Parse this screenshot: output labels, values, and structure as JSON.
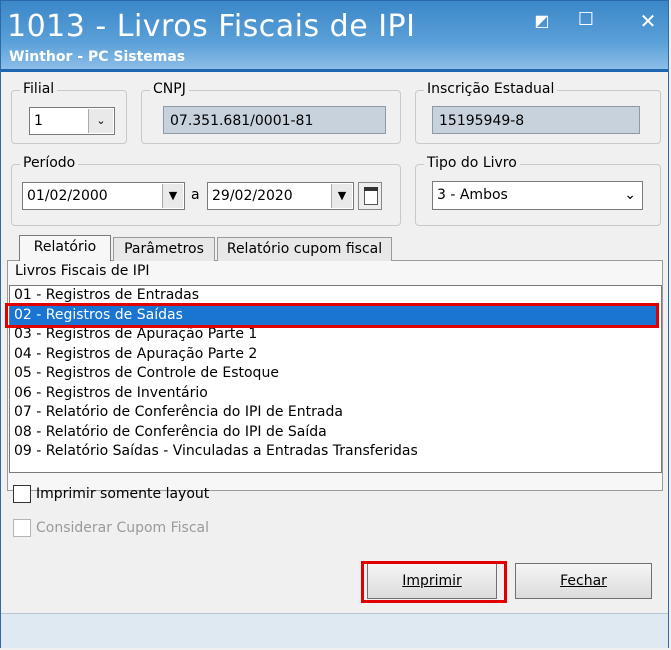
{
  "window": {
    "title": "1013 - Livros Fiscais de IPI",
    "subtitle": "Winthor - PC Sistemas",
    "controls": {
      "restore": "◩",
      "maximize": "☐",
      "close": "✕"
    }
  },
  "filial": {
    "label": "Filial",
    "value": "1"
  },
  "cnpj": {
    "label": "CNPJ",
    "value": "07.351.681/0001-81"
  },
  "inscricao": {
    "label": "Inscrição Estadual",
    "value": "15195949-8"
  },
  "periodo": {
    "label": "Período",
    "start": "01/02/2000",
    "separator": "a",
    "end": "29/02/2020"
  },
  "tipo_livro": {
    "label": "Tipo do Livro",
    "value": "3 - Ambos"
  },
  "tabs": [
    {
      "label": "Relatório",
      "active": true
    },
    {
      "label": "Parâmetros",
      "active": false
    },
    {
      "label": "Relatório cupom fiscal",
      "active": false
    }
  ],
  "livros": {
    "label": "Livros Fiscais de IPI",
    "items": [
      "01 - Registros de Entradas",
      "02 - Registros de Saídas",
      "03 - Registros de Apuração Parte 1",
      "04 - Registros de Apuração Parte 2",
      "05 - Registros de Controle de Estoque",
      "06 - Registros de Inventário",
      "07 - Relatório de Conferência do IPI de Entrada",
      "08 - Relatório de Conferência do IPI de Saída",
      "09 - Relatório Saídas - Vinculadas a Entradas Transferidas"
    ],
    "selected_index": 1
  },
  "options": {
    "imprimir_layout": "Imprimir somente layout",
    "considerar_cupom": "Considerar Cupom Fiscal"
  },
  "buttons": {
    "imprimir": "Imprimir",
    "fechar": "Fechar"
  },
  "colors": {
    "selection": "#1a74d2",
    "highlight": "#e00000",
    "titlebar": "#3b87c8"
  }
}
